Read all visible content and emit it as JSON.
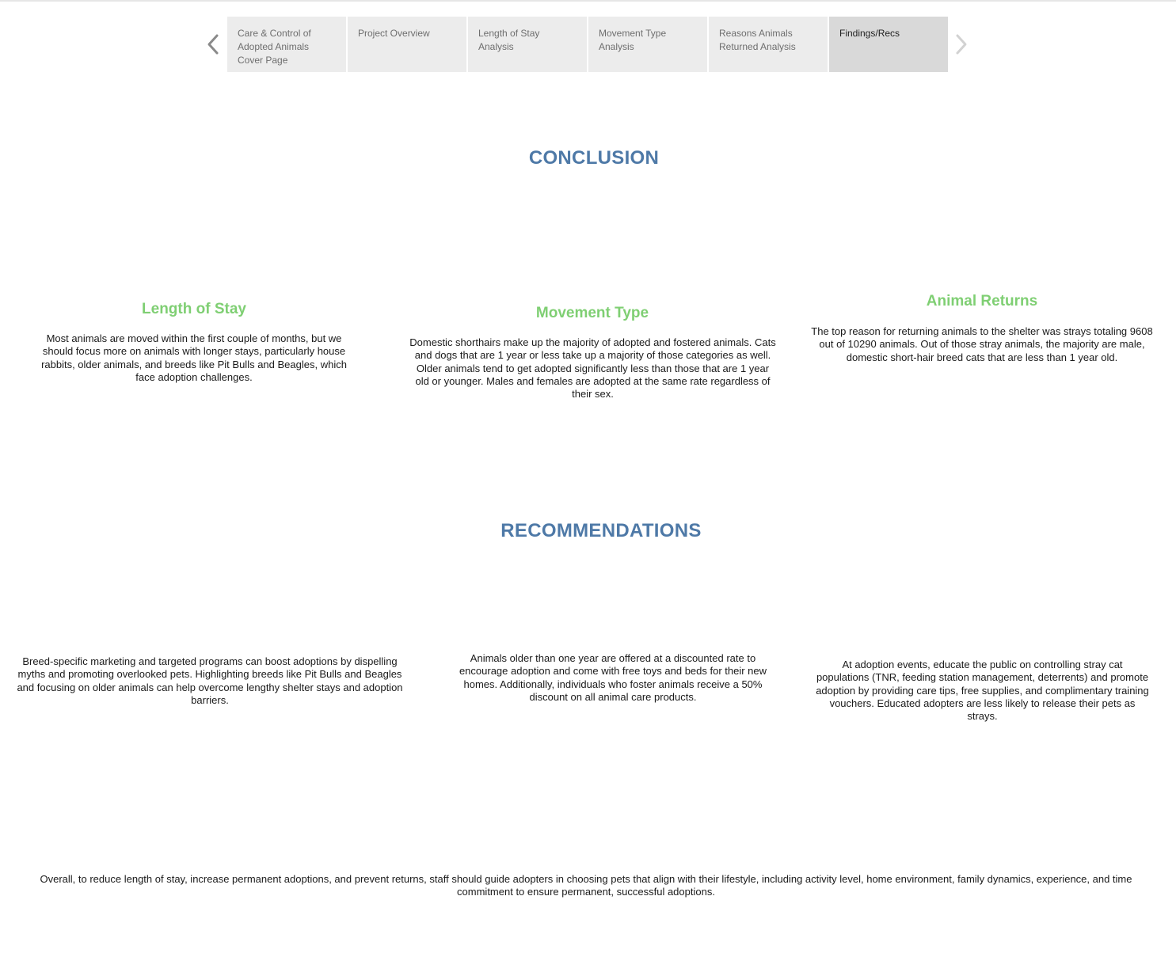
{
  "story_nav": {
    "prev_icon": "chevron-left-icon",
    "next_icon": "chevron-right-icon",
    "tabs": [
      {
        "label": "Care & Control of Adopted Animals Cover Page",
        "active": false
      },
      {
        "label": "Project Overview",
        "active": false
      },
      {
        "label": "Length of Stay Analysis",
        "active": false
      },
      {
        "label": "Movement Type Analysis",
        "active": false
      },
      {
        "label": "Reasons Animals Returned Analysis",
        "active": false
      },
      {
        "label": "Findings/Recs",
        "active": true
      }
    ]
  },
  "conclusion": {
    "title": "CONCLUSION",
    "length_of_stay": {
      "title": "Length of Stay",
      "text": "Most animals are moved within the first couple of months, but we should focus more on animals with longer stays, particularly house rabbits, older animals, and breeds like Pit Bulls and Beagles, which face adoption challenges."
    },
    "movement_type": {
      "title": "Movement Type",
      "text": "Domestic shorthairs make up the majority of adopted and fostered animals. Cats and dogs that are 1 year or less take up a majority of those categories as well. Older animals tend to get adopted significantly less than those that are 1 year old or younger. Males and females are adopted at the same rate regardless of their sex."
    },
    "animal_returns": {
      "title": "Animal Returns",
      "text": "The top reason for returning animals to the shelter was strays totaling 9608 out of 10290 animals. Out of those stray animals, the majority are male, domestic short-hair breed cats that are less than 1 year old."
    }
  },
  "recommendations": {
    "title": "RECOMMENDATIONS",
    "rec_1": "Breed-specific marketing and targeted programs can boost adoptions by dispelling myths and promoting overlooked pets. Highlighting breeds like Pit Bulls and Beagles and focusing on older animals can help overcome lengthy shelter stays and adoption barriers.",
    "rec_2": "Animals older than one year are offered at a discounted rate to encourage adoption and come with free toys and beds for their new homes. Additionally, individuals who foster animals receive a 50% discount on all animal care products.",
    "rec_3": "At adoption events, educate the public on controlling stray cat populations (TNR, feeding station management, deterrents) and promote adoption by providing care tips, free supplies, and complimentary training vouchers. Educated adopters are less likely to release their pets as strays.",
    "overall": "Overall, to reduce length of stay, increase permanent adoptions, and prevent returns, staff should guide adopters in choosing pets that align with their lifestyle, including activity level, home environment, family dynamics, experience, and time commitment to ensure permanent, successful adoptions."
  },
  "colors": {
    "heading_blue": "#4e79a7",
    "subheading_green": "#7fcf73",
    "tab_bg": "#ececec",
    "tab_active_bg": "#d9d9d9"
  }
}
